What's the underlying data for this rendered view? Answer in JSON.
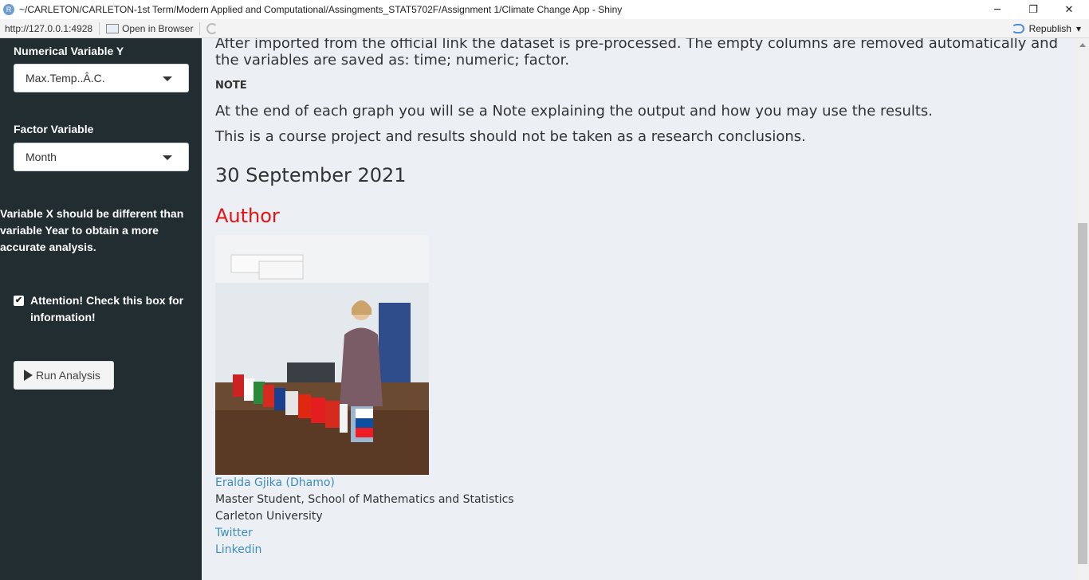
{
  "window": {
    "app_icon_glyph": "R",
    "title": "~/CARLETON/CARLETON-1st Term/Modern Applied and Computational/Assingments_STAT5702F/Assignment 1/Climate Change App - Shiny",
    "minimize": "─",
    "restore": "❐",
    "close": "✕"
  },
  "toolbar": {
    "url": "http://127.0.0.1:4928",
    "open_browser": "Open in Browser",
    "republish": "Republish",
    "republish_caret": "▾"
  },
  "sidebar": {
    "numerical_label": "Numerical Variable Y",
    "numerical_value": "Max.Temp..Â.C.",
    "factor_label": "Factor Variable",
    "factor_value": "Month",
    "warning": "Variable X should be different than variable Year to obtain a more accurate analysis.",
    "checkbox_checked": true,
    "checkbox_mark": "✔",
    "checkbox_label": "Attention! Check this box for information!",
    "run_button": "Run Analysis"
  },
  "main": {
    "intro": "After imported from the official link the dataset is pre-processed. The empty columns are removed automatically and the variables are saved as: time; numeric; factor.",
    "note_heading": "NOTE",
    "note_line1": "At the end of each graph you will se a Note explaining the output and how you may use the results.",
    "note_line2": "This is a course project and results should not be taken as a research conclusions.",
    "date": "30 September 2021",
    "author_heading": "Author",
    "author_name": "Eralda Gjika (Dhamo)",
    "author_role": "Master Student, School of Mathematics and Statistics",
    "author_university": "Carleton University",
    "twitter": "Twitter",
    "linkedin": "Linkedin"
  }
}
